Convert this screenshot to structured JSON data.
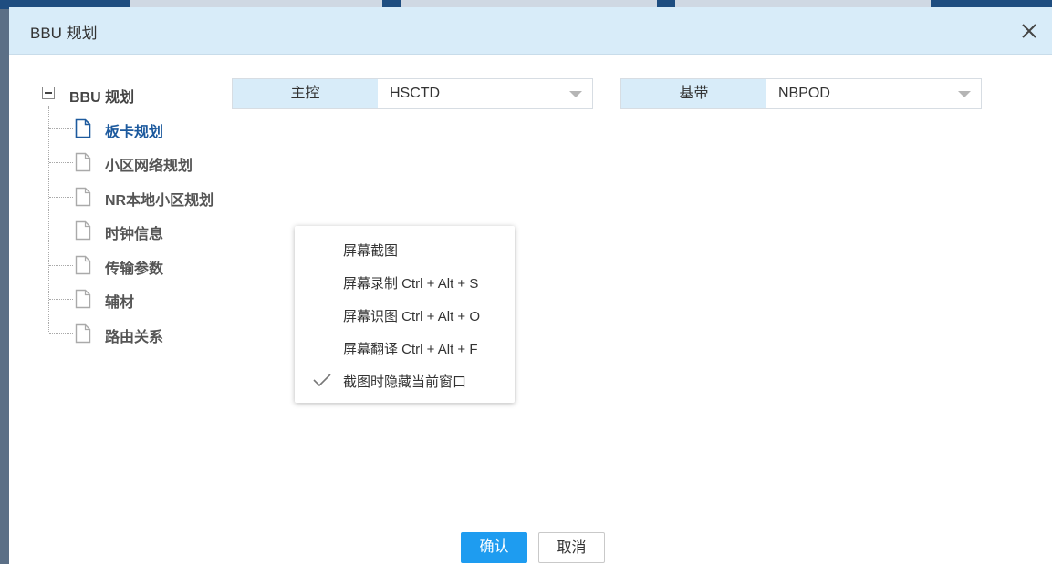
{
  "dialog": {
    "title": "BBU 规划",
    "close_icon": "close-icon"
  },
  "tree": {
    "root_label": "BBU 规划",
    "items": [
      {
        "label": "板卡规划",
        "active": true
      },
      {
        "label": "小区网络规划",
        "active": false
      },
      {
        "label": "NR本地小区规划",
        "active": false
      },
      {
        "label": "时钟信息",
        "active": false
      },
      {
        "label": "传输参数",
        "active": false
      },
      {
        "label": "辅材",
        "active": false
      },
      {
        "label": "路由关系",
        "active": false
      }
    ]
  },
  "selectors": {
    "main_control": {
      "label": "主控",
      "value": "HSCTD"
    },
    "baseband": {
      "label": "基带",
      "value": "NBPOD"
    }
  },
  "context_menu": {
    "items": [
      {
        "label": "屏幕截图",
        "checked": false
      },
      {
        "label": "屏幕录制 Ctrl + Alt + S",
        "checked": false
      },
      {
        "label": "屏幕识图 Ctrl + Alt + O",
        "checked": false
      },
      {
        "label": "屏幕翻译 Ctrl + Alt + F",
        "checked": false
      },
      {
        "label": "截图时隐藏当前窗口",
        "checked": true
      }
    ]
  },
  "buttons": {
    "confirm": "确认",
    "cancel": "取消"
  },
  "colors": {
    "header_bg": "#d8ecf9",
    "primary": "#1e9cf0",
    "active_tree_item": "#1d5a9e"
  }
}
